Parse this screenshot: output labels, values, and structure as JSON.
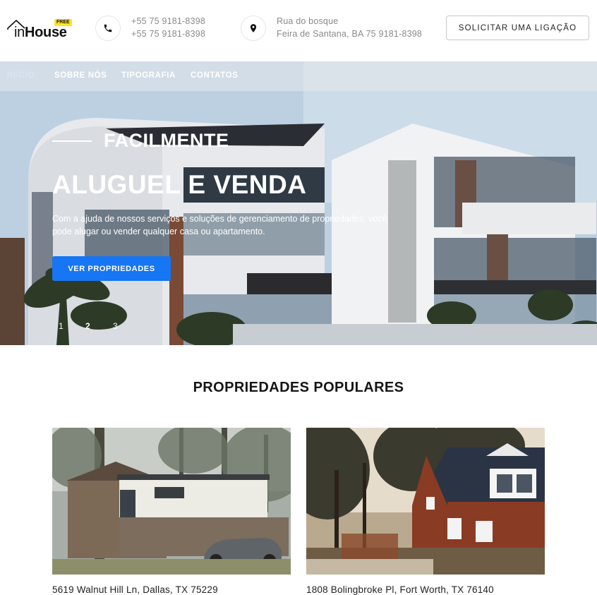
{
  "logo": {
    "in": "in",
    "house": "House",
    "badge": "FREE"
  },
  "contact": {
    "phone_icon": "phone-icon",
    "phones": [
      "+55 75 9181-8398",
      "+55 75 9181-8398"
    ],
    "pin_icon": "map-pin-icon",
    "address": [
      "Rua do bosque",
      "Feira de Santana, BA 75 9181-8398"
    ]
  },
  "call_button": "SOLICITAR UMA LIGAÇÃO",
  "nav": {
    "items": [
      {
        "label": "INÍCIO",
        "active": true
      },
      {
        "label": "SOBRE NÓS",
        "active": false
      },
      {
        "label": "TIPOGRAFIA",
        "active": false
      },
      {
        "label": "CONTATOS",
        "active": false
      }
    ]
  },
  "hero": {
    "eyebrow": "FACILMENTE",
    "title": "ALUGUEL E VENDA",
    "description": "Com a ajuda de nossos serviços e soluções de gerenciamento de propriedades, você pode alugar ou vender qualquer casa ou apartamento.",
    "button": "VER PROPRIEDADES",
    "slides": [
      "1",
      "2",
      "3"
    ],
    "active_slide": 2,
    "accent_color": "#1676f3"
  },
  "popular": {
    "title": "PROPRIEDADES POPULARES",
    "cards": [
      {
        "address": "5619 Walnut Hill Ln, Dallas, TX 75229"
      },
      {
        "address": "1808 Bolingbroke Pl, Fort Worth, TX 76140"
      }
    ]
  }
}
